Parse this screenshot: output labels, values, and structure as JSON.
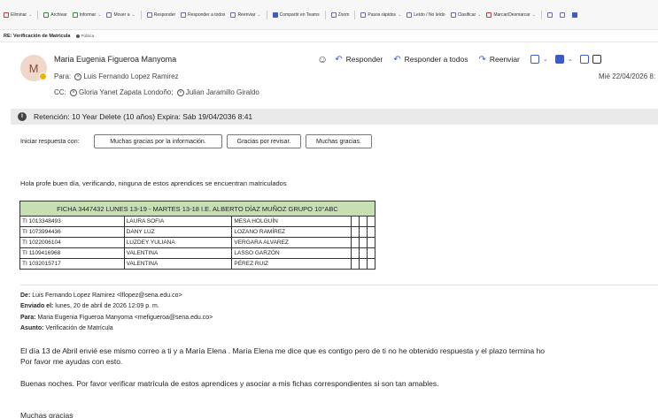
{
  "ribbon": {
    "items": [
      {
        "label": "Eliminar",
        "chev": "⌄"
      },
      {
        "label": "Archivar",
        "chev": ""
      },
      {
        "label": "Informar",
        "chev": "⌄"
      },
      {
        "label": "Mover a",
        "chev": "⌄"
      },
      {
        "label": "Responder",
        "chev": ""
      },
      {
        "label": "Responder a todos",
        "chev": ""
      },
      {
        "label": "Reenviar",
        "chev": "⌄"
      },
      {
        "label": "Compartir en Teams",
        "chev": ""
      },
      {
        "label": "Zoom",
        "chev": ""
      },
      {
        "label": "Pasos rápidos",
        "chev": "⌄"
      },
      {
        "label": "Leído / No leído",
        "chev": ""
      },
      {
        "label": "Clasificar",
        "chev": "⌄"
      },
      {
        "label": "Marcar/Desmarcar",
        "chev": "⌄"
      }
    ]
  },
  "subject": "RE: Verificación de Matrícula",
  "public_label": "Pública",
  "header": {
    "avatar_initial": "M",
    "sender": "Maria Eugenia Figueroa Manyoma",
    "to_label": "Para:",
    "to": "Luis Fernando Lopez Ramirez",
    "cc_label": "CC:",
    "cc1": "Gloria Yanet Zapata Londoño;",
    "cc2": "Julian Jaramillo Giraldo",
    "date": "Mié 22/04/2026 8:"
  },
  "actions": {
    "reply": "Responder",
    "reply_all": "Responder a todos",
    "forward": "Reenviar"
  },
  "retention": "Retención: 10 Year Delete (10 años) Expira: Sáb 19/04/2036 8:41",
  "quick_reply": {
    "label": "Iniciar respuesta con:",
    "options": [
      "Muchas gracias por la información.",
      "Gracias por revisar.",
      "Muchas gracias."
    ]
  },
  "body": {
    "greeting": "Hola profe  buen día, verificando, ninguna de estos aprendices se encuentran matriculados",
    "table": {
      "header": "FICHA 3447432   LUNES 13-19 - MARTES 13-18   I.E. ALBERTO DÍAZ MUÑOZ  GRUPO 10°ABC",
      "rows": [
        [
          "TI 1013348493",
          "LAURA SOFIA",
          "MESA HOLGUÍN"
        ],
        [
          "TI 1073994436",
          "DANY LUZ",
          "LOZANO RAMÍREZ"
        ],
        [
          "TI 1022006104",
          "LUZDEY YULIANA",
          "VERGARA ALVAREZ"
        ],
        [
          "TI 1109416968",
          "VALENTINA",
          "LASSO GARZÓN"
        ],
        [
          "TI 1032015717",
          "VALENTINA",
          "PÉREZ RUIZ"
        ]
      ]
    },
    "from_label": "De:",
    "from_value": "Luis Fernando Lopez Ramirez <lflopez@sena.edu.co>",
    "sent_label": "Enviado el:",
    "sent_value": "lunes, 20 de abril de 2026 12:09 p. m.",
    "para_label": "Para:",
    "para_value": "Maria Eugenia Figueroa Manyoma <mefigueroa@sena.edu.co>",
    "subject_label": "Asunto:",
    "subject_value": "Verificación de Matrícula",
    "p1": "El día 13 de Abril envié ese mismo correo a ti y a María Elena . María Elena me dice que es contigo pero de ti no he obtenido respuesta y el plazo termina ho",
    "p2": "Por favor me ayudas con esto.",
    "p3": "Buenas noches.  Por favor verificar matrícula de estos aprendices y asociar a mis fichas correspondientes si son tan amables.",
    "p4": "Muchas gracias"
  }
}
